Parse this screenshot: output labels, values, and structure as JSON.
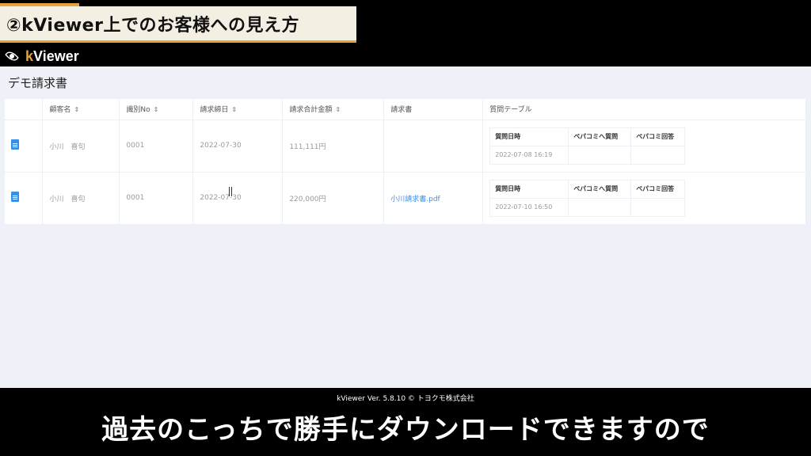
{
  "caption_top": "②kViewer上でのお客様への見え方",
  "app": {
    "logo_k": "k",
    "logo_rest": "Viewer"
  },
  "page_title": "デモ請求書",
  "columns": [
    "顧客名",
    "識別No",
    "請求締日",
    "請求合計金額",
    "請求書",
    "質問テーブル"
  ],
  "sort_glyph": "⇕",
  "sub_columns": [
    "質問日時",
    "ペパコミへ質問",
    "ペパコミ回答"
  ],
  "rows": [
    {
      "customer": "小川　喜句",
      "id_no": "0001",
      "closing_date": "2022-07-30",
      "amount": "111,111円",
      "invoice": "",
      "question_date": "2022-07-08 16:19"
    },
    {
      "customer": "小川　喜句",
      "id_no": "0001",
      "closing_date": "2022-07-30",
      "amount": "220,000円",
      "invoice": "小川請求書.pdf",
      "question_date": "2022-07-10 16:50"
    }
  ],
  "footer": "kViewer  Ver. 5.8.10  © トヨクモ株式会社",
  "caption_bottom": "過去のこっちで勝手にダウンロードできますので"
}
